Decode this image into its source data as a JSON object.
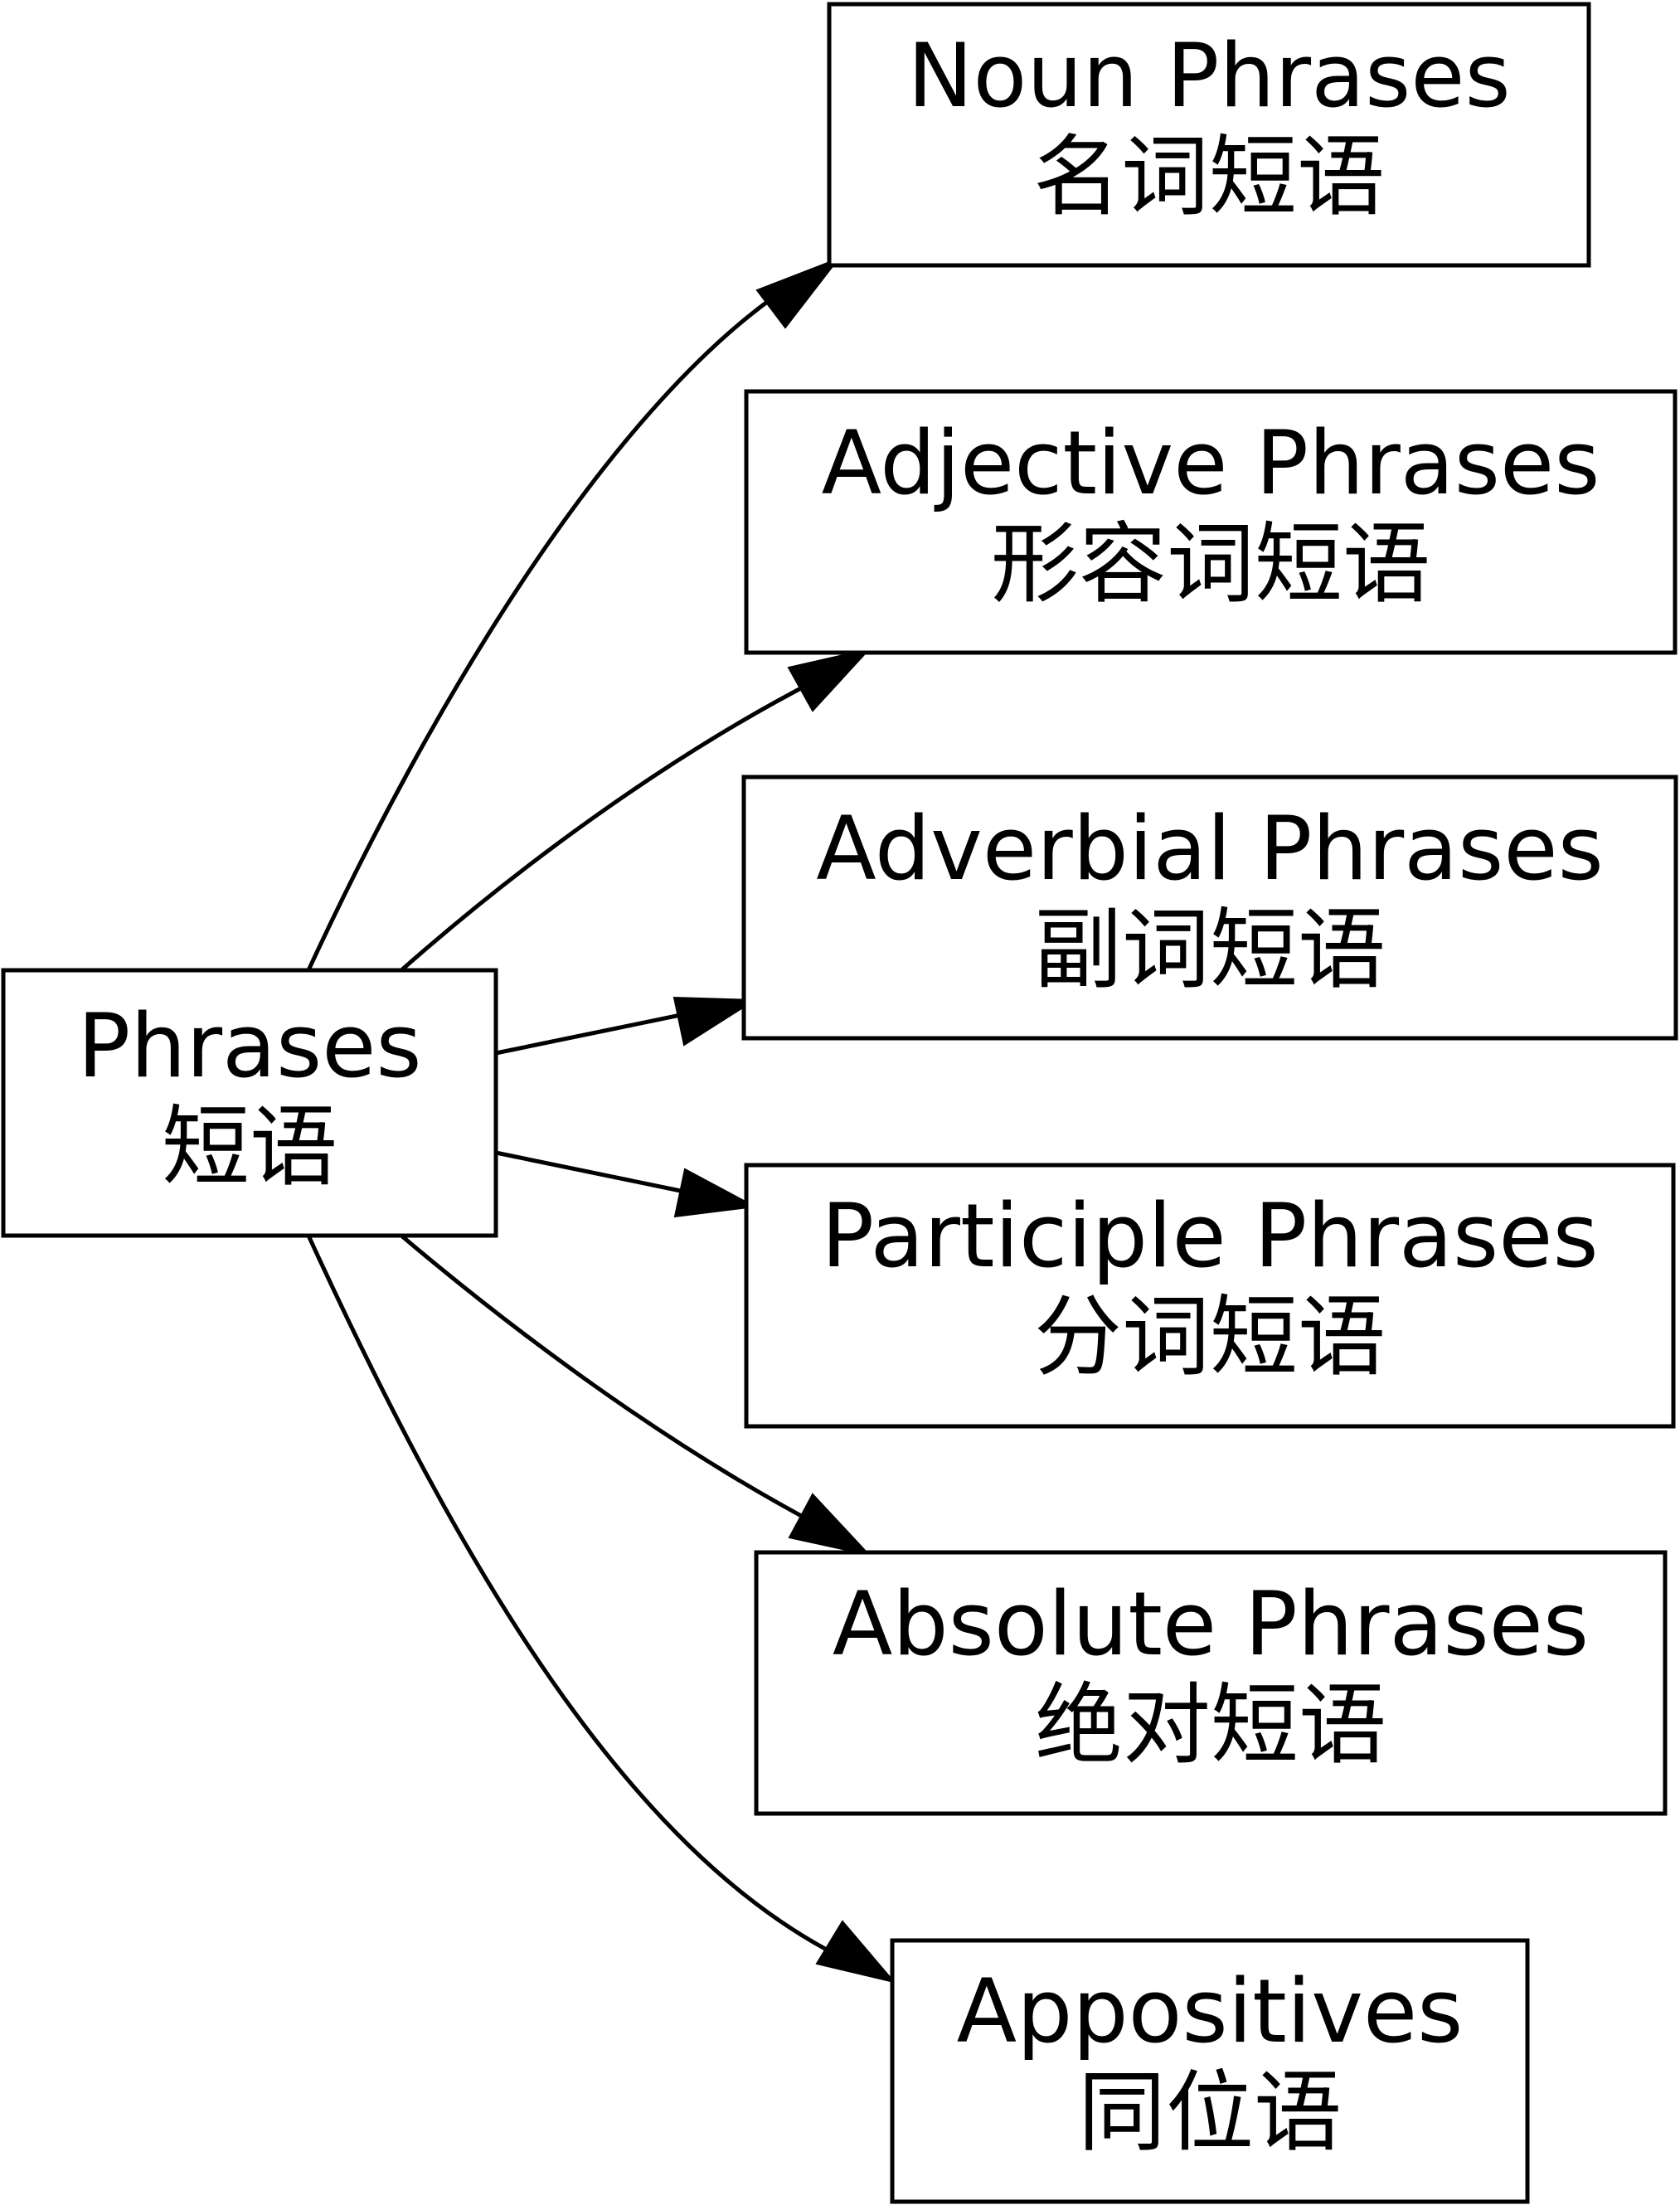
{
  "diagram": {
    "root": {
      "label_en": "Phrases",
      "label_zh": "短语"
    },
    "children": [
      {
        "id": "noun",
        "label_en": "Noun Phrases",
        "label_zh": "名词短语"
      },
      {
        "id": "adjective",
        "label_en": "Adjective Phrases",
        "label_zh": "形容词短语"
      },
      {
        "id": "adverbial",
        "label_en": "Adverbial Phrases",
        "label_zh": "副词短语"
      },
      {
        "id": "participle",
        "label_en": "Participle Phrases",
        "label_zh": "分词短语"
      },
      {
        "id": "absolute",
        "label_en": "Absolute Phrases",
        "label_zh": "绝对短语"
      },
      {
        "id": "appositives",
        "label_en": "Appositives",
        "label_zh": "同位语"
      }
    ],
    "edges": [
      {
        "from": "root",
        "to": "noun"
      },
      {
        "from": "root",
        "to": "adjective"
      },
      {
        "from": "root",
        "to": "adverbial"
      },
      {
        "from": "root",
        "to": "participle"
      },
      {
        "from": "root",
        "to": "absolute"
      },
      {
        "from": "root",
        "to": "appositives"
      }
    ],
    "colors": {
      "stroke": "#000000",
      "fill": "#ffffff",
      "text": "#000000"
    }
  }
}
